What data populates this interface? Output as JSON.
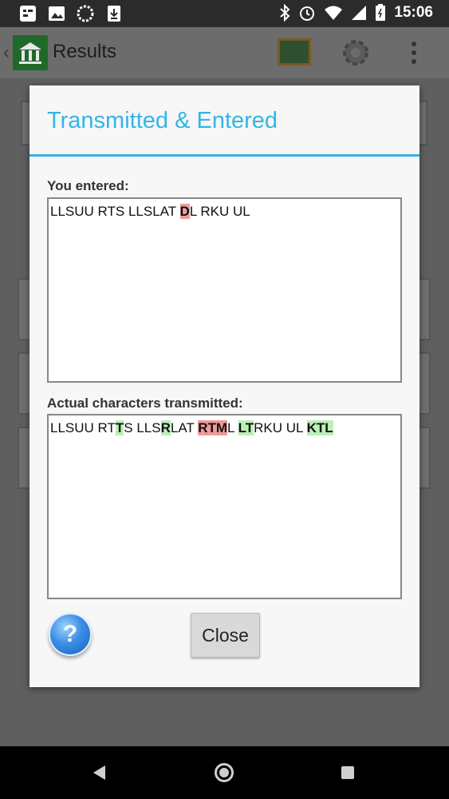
{
  "status_bar": {
    "time": "15:06",
    "icons_left": [
      "notification-icon",
      "image-icon",
      "circle-icon",
      "download-icon"
    ],
    "icons_right": [
      "bluetooth-icon",
      "alarm-icon",
      "wifi-icon",
      "signal-icon",
      "battery-icon"
    ]
  },
  "app_bar": {
    "title": "Results"
  },
  "dialog": {
    "title": "Transmitted & Entered",
    "entered_label": "You entered:",
    "entered_segments": [
      {
        "text": "LLSUU RTS LLSLAT ",
        "style": "plain"
      },
      {
        "text": "D",
        "style": "red"
      },
      {
        "text": "L RKU UL",
        "style": "plain"
      }
    ],
    "transmitted_label": "Actual characters transmitted:",
    "transmitted_segments": [
      {
        "text": "LLSUU RT",
        "style": "plain"
      },
      {
        "text": "T",
        "style": "green"
      },
      {
        "text": "S LLS",
        "style": "plain"
      },
      {
        "text": "R",
        "style": "green"
      },
      {
        "text": "LAT ",
        "style": "plain"
      },
      {
        "text": "RTM",
        "style": "red"
      },
      {
        "text": "L ",
        "style": "plain"
      },
      {
        "text": "LT",
        "style": "green"
      },
      {
        "text": "RKU UL ",
        "style": "plain"
      },
      {
        "text": "KTL",
        "style": "green"
      }
    ],
    "help_symbol": "?",
    "close_label": "Close"
  },
  "colors": {
    "accent": "#33b5e5",
    "error_highlight": "#f09b98",
    "correct_highlight": "#b9f0b6"
  }
}
